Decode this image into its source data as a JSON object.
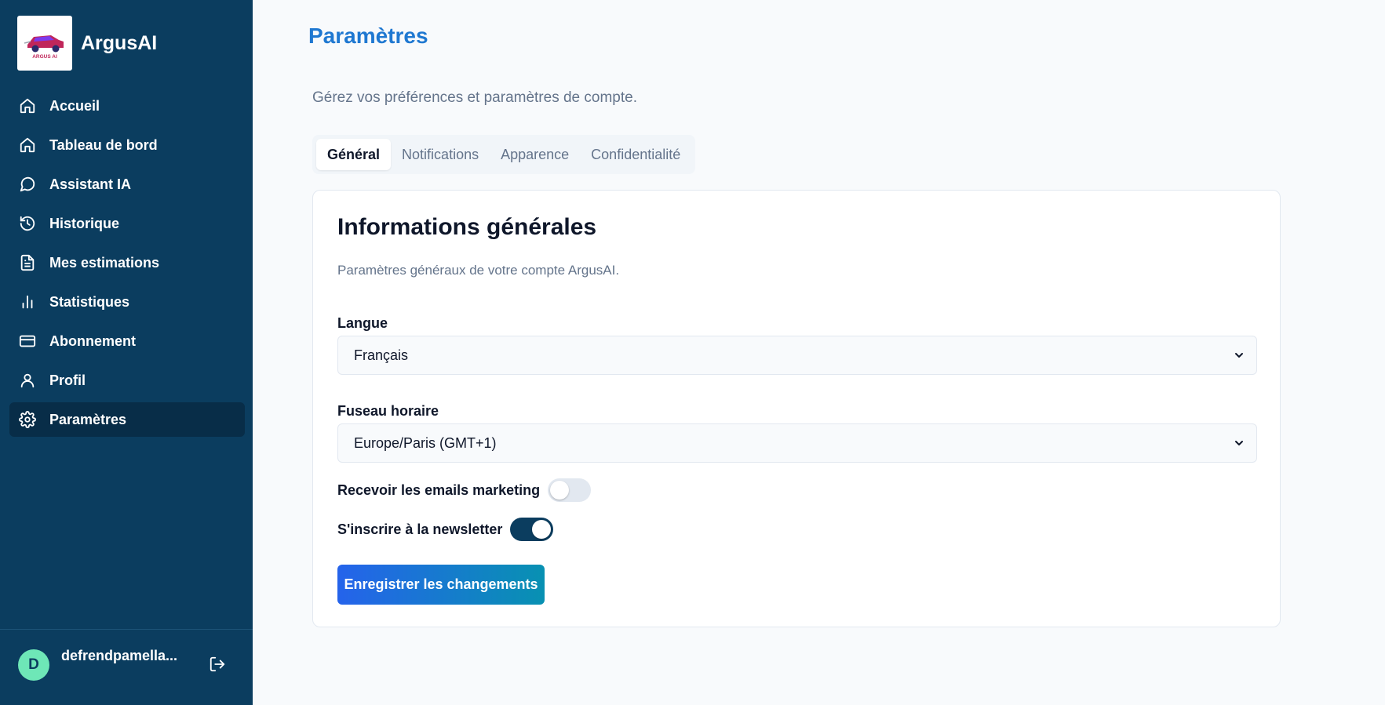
{
  "brand": {
    "name": "ArgusAI",
    "logo_text": "ARGUS AI"
  },
  "sidebar": {
    "items": [
      {
        "label": "Accueil",
        "icon": "home-icon"
      },
      {
        "label": "Tableau de bord",
        "icon": "home-icon"
      },
      {
        "label": "Assistant IA",
        "icon": "chat-icon"
      },
      {
        "label": "Historique",
        "icon": "history-icon"
      },
      {
        "label": "Mes estimations",
        "icon": "document-icon"
      },
      {
        "label": "Statistiques",
        "icon": "bar-chart-icon"
      },
      {
        "label": "Abonnement",
        "icon": "credit-card-icon"
      },
      {
        "label": "Profil",
        "icon": "user-icon"
      },
      {
        "label": "Paramètres",
        "icon": "gear-icon",
        "active": true
      }
    ]
  },
  "user": {
    "initial": "D",
    "name": "defrendpamella..."
  },
  "page": {
    "title": "Paramètres",
    "subtitle": "Gérez vos préférences et paramètres de compte."
  },
  "tabs": [
    {
      "label": "Général",
      "active": true
    },
    {
      "label": "Notifications"
    },
    {
      "label": "Apparence"
    },
    {
      "label": "Confidentialité"
    }
  ],
  "card": {
    "title": "Informations générales",
    "description": "Paramètres généraux de votre compte ArgusAI.",
    "language": {
      "label": "Langue",
      "value": "Français"
    },
    "timezone": {
      "label": "Fuseau horaire",
      "value": "Europe/Paris (GMT+1)"
    },
    "marketing": {
      "label": "Recevoir les emails marketing",
      "checked": false
    },
    "newsletter": {
      "label": "S'inscrire à la newsletter",
      "checked": true
    },
    "save_label": "Enregistrer les changements"
  },
  "colors": {
    "sidebar_bg": "#0b3d5f",
    "sidebar_active": "#082d48",
    "title_blue": "#1f78d1",
    "button_start": "#2563eb",
    "button_end": "#0891b2",
    "avatar_bg": "#6ee7b7"
  }
}
